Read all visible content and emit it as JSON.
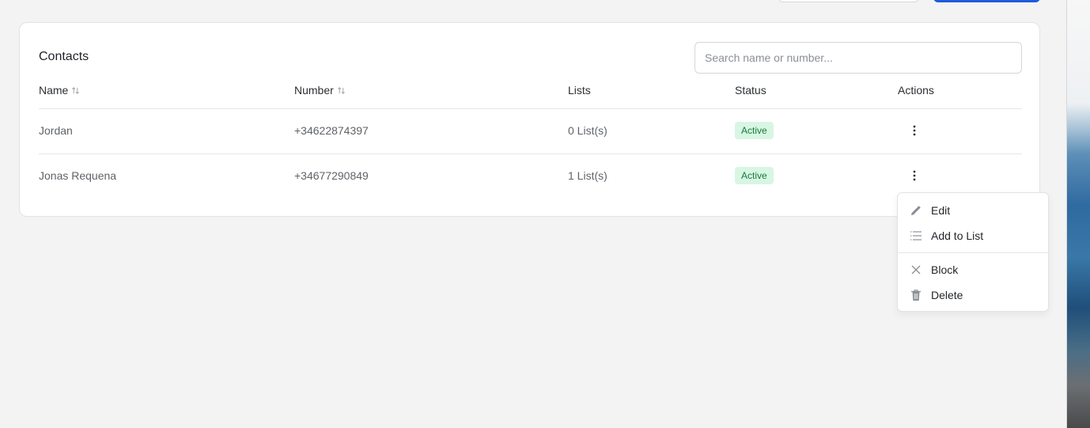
{
  "contacts": {
    "title": "Contacts",
    "search_placeholder": "Search name or number...",
    "columns": [
      "Name",
      "Number",
      "Lists",
      "Status",
      "Actions"
    ],
    "rows": [
      {
        "name": "Jordan",
        "number": "+34622874397",
        "lists": "0 List(s)",
        "status": "Active"
      },
      {
        "name": "Jonas Requena",
        "number": "+34677290849",
        "lists": "1 List(s)",
        "status": "Active"
      }
    ]
  },
  "action_menu": {
    "items": [
      "Edit",
      "Add to List",
      "Block",
      "Delete"
    ],
    "icons": [
      "pencil-icon",
      "list-icon",
      "close-icon",
      "trash-icon"
    ]
  },
  "colors": {
    "badge_bg": "#d8f6e3",
    "badge_text": "#177a3c",
    "primary": "#1e5bd8"
  }
}
